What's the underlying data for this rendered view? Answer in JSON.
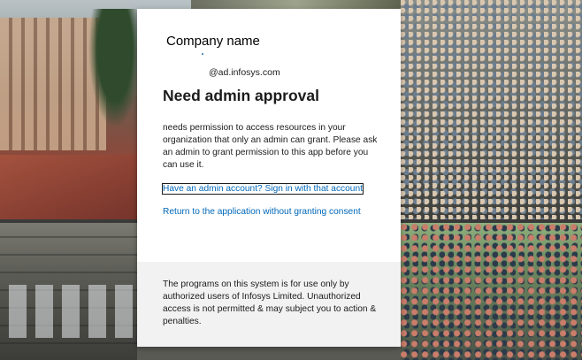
{
  "brand": {
    "name": "Company name"
  },
  "account": {
    "email": "@ad.infosys.com"
  },
  "dialog": {
    "title": "Need admin approval",
    "description": "needs permission to access resources in your organization that only an admin can grant. Please ask an admin to grant permission to this app before you can use it.",
    "signin_link": "Have an admin account? Sign in with that account",
    "return_link": "Return to the application without granting consent"
  },
  "footer": {
    "notice": "The programs on this system is for use only by authorized users of Infosys Limited. Unauthorized access is not permitted & may subject you to action & penalties."
  },
  "colors": {
    "link": "#0067b8",
    "footer_bg": "#f2f2f2",
    "text": "#1b1b1b"
  }
}
